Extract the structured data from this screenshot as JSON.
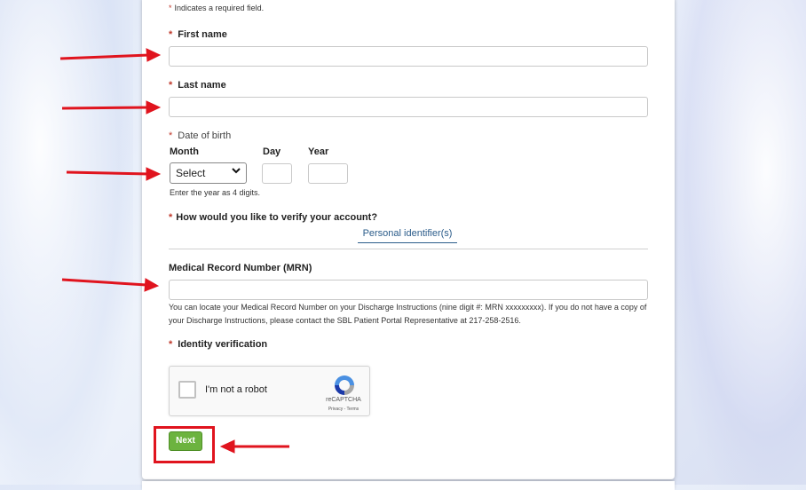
{
  "form": {
    "required_note_star": "*",
    "required_note": "Indicates a required field.",
    "star": "*",
    "first_name_label": "First name",
    "last_name_label": "Last name",
    "dob_label": "Date of birth",
    "month_label": "Month",
    "day_label": "Day",
    "year_label": "Year",
    "month_select_value": "Select",
    "year_hint": "Enter the year as 4 digits.",
    "verify_question": "How would you like to verify your account?",
    "verify_tab": "Personal identifier(s)",
    "mrn_label": "Medical Record Number (MRN)",
    "mrn_help": "You can locate your Medical Record Number on your Discharge Instructions (nine digit #: MRN xxxxxxxxx). If you do not have a copy of your Discharge Instructions, please contact the SBL Patient Portal Representative at 217-258-2516.",
    "identity_label": "Identity verification",
    "next_button": "Next"
  },
  "captcha": {
    "label": "I'm not a robot",
    "brand": "reCAPTCHA",
    "links": "Privacy - Terms"
  },
  "colors": {
    "required": "#c0392b",
    "next_button": "#6cb33f",
    "annotation_arrow": "#e0141e",
    "tab_text": "#2b5c8a"
  }
}
